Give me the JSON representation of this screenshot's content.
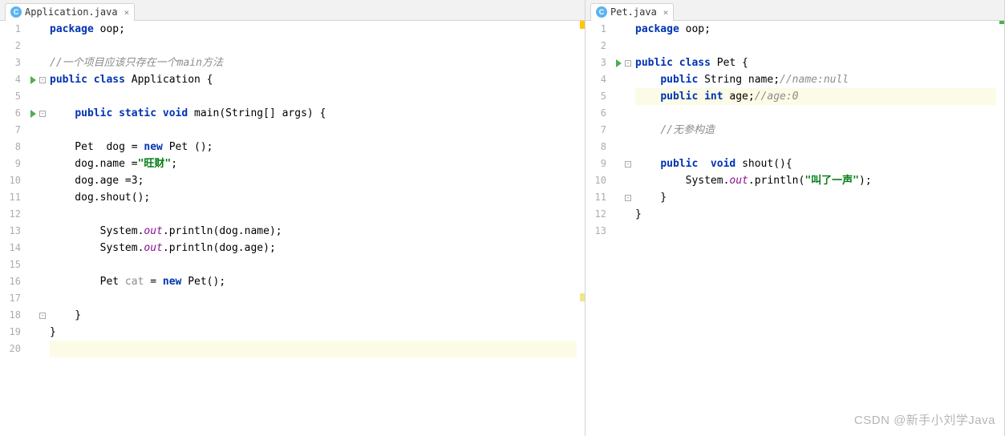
{
  "watermark": "CSDN @新手小刘学Java",
  "left": {
    "tab": {
      "icon": "C",
      "label": "Application.java"
    },
    "highlightLine": 20,
    "runMarkers": [
      4,
      6
    ],
    "foldMarkers": {
      "4": "-",
      "6": "-",
      "18": "-"
    },
    "lines": [
      [
        [
          "kw",
          "package "
        ],
        [
          "pln",
          "oop;"
        ]
      ],
      [],
      [
        [
          "cmt",
          "//一个项目应该只存在一个main方法"
        ]
      ],
      [
        [
          "kw",
          "public class "
        ],
        [
          "type",
          "Application"
        ],
        [
          "pln",
          " {"
        ]
      ],
      [],
      [
        [
          "pln",
          "    "
        ],
        [
          "kw",
          "public static void "
        ],
        [
          "pln",
          "main(String[] args) {"
        ]
      ],
      [],
      [
        [
          "pln",
          "    Pet  dog = "
        ],
        [
          "kw",
          "new "
        ],
        [
          "pln",
          "Pet ();"
        ]
      ],
      [
        [
          "pln",
          "    dog.name ="
        ],
        [
          "str",
          "\"旺财\""
        ],
        [
          "pln",
          ";"
        ]
      ],
      [
        [
          "pln",
          "    dog.age =3;"
        ]
      ],
      [
        [
          "pln",
          "    dog.shout();"
        ]
      ],
      [],
      [
        [
          "pln",
          "        System."
        ],
        [
          "static-field",
          "out"
        ],
        [
          "pln",
          ".println(dog.name);"
        ]
      ],
      [
        [
          "pln",
          "        System."
        ],
        [
          "static-field",
          "out"
        ],
        [
          "pln",
          ".println(dog.age);"
        ]
      ],
      [],
      [
        [
          "pln",
          "        Pet "
        ],
        [
          "unused",
          "cat"
        ],
        [
          "pln",
          " = "
        ],
        [
          "kw",
          "new "
        ],
        [
          "pln",
          "Pet();"
        ]
      ],
      [],
      [
        [
          "pln",
          "    }"
        ]
      ],
      [
        [
          "pln",
          "}"
        ]
      ],
      []
    ]
  },
  "right": {
    "tab": {
      "icon": "C",
      "label": "Pet.java"
    },
    "highlightLine": 5,
    "runMarkers": [
      3
    ],
    "foldMarkers": {
      "3": "-",
      "9": "-",
      "11": "-"
    },
    "lines": [
      [
        [
          "kw",
          "package "
        ],
        [
          "pln",
          "oop;"
        ]
      ],
      [],
      [
        [
          "kw",
          "public class "
        ],
        [
          "type",
          "Pet"
        ],
        [
          "pln",
          " {"
        ]
      ],
      [
        [
          "pln",
          "    "
        ],
        [
          "kw",
          "public "
        ],
        [
          "pln",
          "String name;"
        ],
        [
          "cmt",
          "//name:null"
        ]
      ],
      [
        [
          "pln",
          "    "
        ],
        [
          "kw",
          "public int "
        ],
        [
          "pln",
          "age;"
        ],
        [
          "cmt",
          "//age:0"
        ]
      ],
      [],
      [
        [
          "pln",
          "    "
        ],
        [
          "cmt",
          "//无参构造"
        ]
      ],
      [],
      [
        [
          "pln",
          "    "
        ],
        [
          "kw",
          "public  void "
        ],
        [
          "pln",
          "shout(){"
        ]
      ],
      [
        [
          "pln",
          "        System."
        ],
        [
          "static-field",
          "out"
        ],
        [
          "pln",
          ".println("
        ],
        [
          "str",
          "\"叫了一声\""
        ],
        [
          "pln",
          ");"
        ]
      ],
      [
        [
          "pln",
          "    }"
        ]
      ],
      [
        [
          "pln",
          "}"
        ]
      ],
      []
    ]
  }
}
